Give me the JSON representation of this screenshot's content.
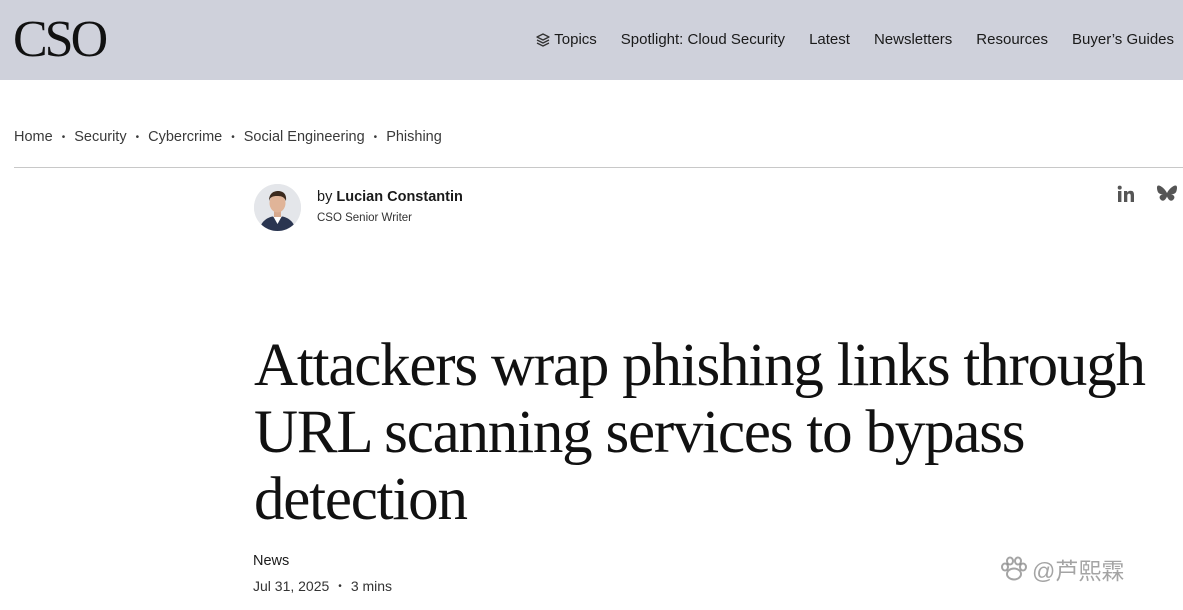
{
  "header": {
    "logo": "CSO",
    "nav": [
      {
        "label": "Topics",
        "icon": "layers-icon"
      },
      {
        "label": "Spotlight: Cloud Security"
      },
      {
        "label": "Latest"
      },
      {
        "label": "Newsletters"
      },
      {
        "label": "Resources"
      },
      {
        "label": "Buyer’s Guides"
      }
    ]
  },
  "breadcrumb": [
    "Home",
    "Security",
    "Cybercrime",
    "Social Engineering",
    "Phishing"
  ],
  "breadcrumb_separator": "•",
  "author": {
    "prefix": "by",
    "name": "Lucian Constantin",
    "role": "CSO Senior Writer"
  },
  "share": [
    "linkedin-icon",
    "bluesky-icon"
  ],
  "article": {
    "headline": "Attackers wrap phishing links through URL scanning services to bypass detection",
    "category": "News",
    "date": "Jul 31, 2025",
    "meta_separator": "•",
    "read_time": "3 mins"
  },
  "watermark": "@芦熙霖",
  "colors": {
    "header_bg": "#cfd1db",
    "text": "#1a1a1a",
    "divider": "#c8c8c8"
  }
}
